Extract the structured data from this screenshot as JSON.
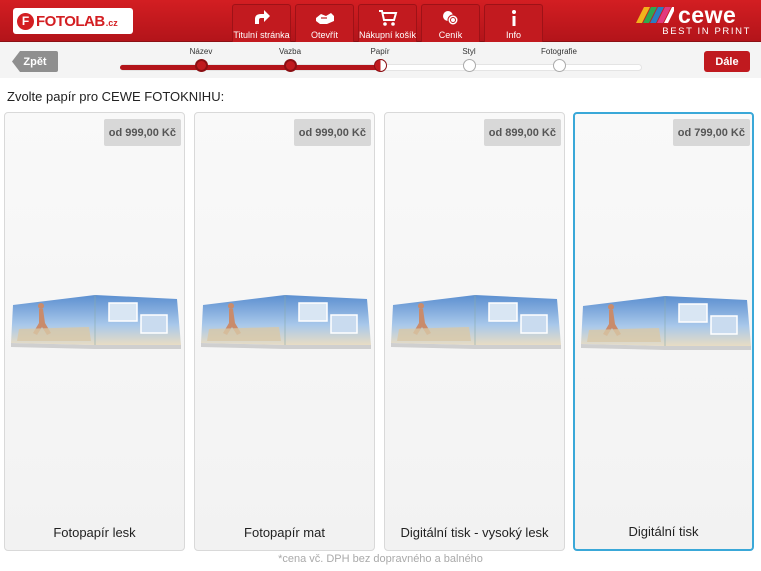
{
  "header": {
    "logo": {
      "text": "FOTOLAB",
      "suffix": ".cz"
    },
    "nav": [
      {
        "label": "Titulní stránka",
        "icon": "home-arrow-icon"
      },
      {
        "label": "Otevřít",
        "icon": "open-hand-icon"
      },
      {
        "label": "Nákupní košík",
        "icon": "cart-icon"
      },
      {
        "label": "Ceník",
        "icon": "coins-icon"
      },
      {
        "label": "Info",
        "icon": "info-icon"
      }
    ],
    "brand": {
      "name": "cewe",
      "tagline": "BEST IN PRINT"
    }
  },
  "stepbar": {
    "back_label": "Zpět",
    "next_label": "Dále",
    "steps": [
      {
        "label": "Název",
        "state": "done"
      },
      {
        "label": "Vazba",
        "state": "done"
      },
      {
        "label": "Papír",
        "state": "current"
      },
      {
        "label": "Styl",
        "state": "pending"
      },
      {
        "label": "Fotografie",
        "state": "pending"
      }
    ]
  },
  "prompt": "Zvolte papír pro CEWE FOTOKNIHU:",
  "cards": [
    {
      "price": "od 999,00 Kč",
      "label": "Fotopapír lesk",
      "selected": false
    },
    {
      "price": "od 999,00 Kč",
      "label": "Fotopapír mat",
      "selected": false
    },
    {
      "price": "od 899,00 Kč",
      "label": "Digitální tisk - vysoký lesk",
      "selected": false
    },
    {
      "price": "od 799,00 Kč",
      "label": "Digitální tisk",
      "selected": true
    }
  ],
  "footnote": "*cena vč. DPH bez dopravného a balného",
  "colors": {
    "accent": "#c01a1f",
    "selected_border": "#3aa8d8"
  }
}
